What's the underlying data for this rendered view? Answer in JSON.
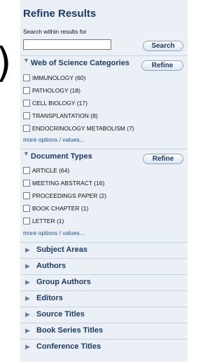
{
  "paren": ")",
  "panel": {
    "title": "Refine Results",
    "search_label": "Search within results for",
    "search_value": "",
    "search_button": "Search",
    "sections": [
      {
        "title": "Web of Science Categories",
        "refine": "Refine",
        "items": [
          "IMMUNOLOGY (60)",
          "PATHOLOGY (18)",
          "CELL BIOLOGY (17)",
          "TRANSPLANTATION (8)",
          "ENDOCRINOLOGY METABOLISM (7)"
        ],
        "more": "more options / values..."
      },
      {
        "title": "Document Types",
        "refine": "Refine",
        "items": [
          "ARTICLE (64)",
          "MEETING ABSTRACT (16)",
          "PROCEEDINGS PAPER (2)",
          "BOOK CHAPTER (1)",
          "LETTER (1)"
        ],
        "more": "more options / values..."
      }
    ],
    "collapsed": [
      "Subject Areas",
      "Authors",
      "Group Authors",
      "Editors",
      "Source Titles",
      "Book Series Titles",
      "Conference Titles"
    ]
  }
}
